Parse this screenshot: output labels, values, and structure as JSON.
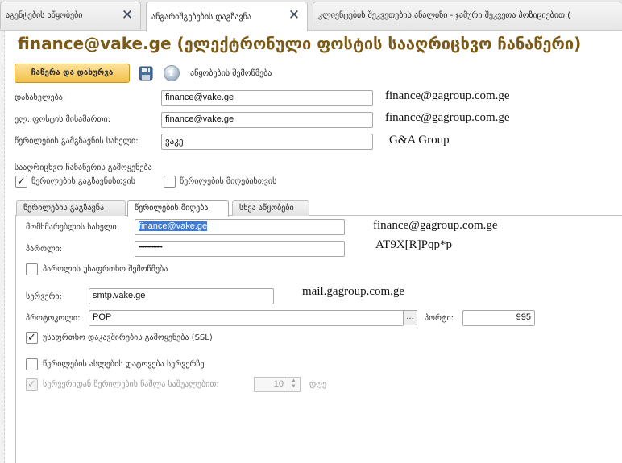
{
  "tabs": [
    {
      "label": "აგენტების აწყობები"
    },
    {
      "label": "ანგარიშგებების დაგზავნა"
    },
    {
      "label": "კლიენტების შეკვეთების ანალიზი - ჯამური შეკვეთა პოზიციებით ("
    }
  ],
  "title": "finance@vake.ge (ელექტრონული ფოსტის სააღრიცხვო ჩანაწერი)",
  "toolbar": {
    "save_close_label": "ჩაწერა და დახურვა",
    "settings_check_label": "აწყობების შემოწმება"
  },
  "account": {
    "name_label": "დასახელება:",
    "name_value": "finance@vake.ge",
    "email_label": "ელ. ფოსტის მისამართი:",
    "email_value": "finance@vake.ge",
    "sender_label": "წერილების გამგზავნის სახელი:",
    "sender_value": "ვაკე",
    "note_name": "finance@gagroup.com.ge",
    "note_email": "finance@gagroup.com.ge",
    "note_sender": "G&A Group"
  },
  "usage": {
    "heading": "სააღრიცხვო ჩანაწერის გამოყენება",
    "send_label": "წერილების გაგზავნისთვის",
    "send_checked": true,
    "receive_label": "წერილების მიღებისთვის",
    "receive_checked": false
  },
  "inner_tabs": [
    {
      "label": "წერილების გაგზავნა"
    },
    {
      "label": "წერილების მიღება"
    },
    {
      "label": "სხვა აწყობები"
    }
  ],
  "receive": {
    "user_label": "მომხმარებლის სახელი:",
    "user_value": "finance@vake.ge",
    "password_label": "პაროლი:",
    "password_value": "••••••••••••••••",
    "secure_pwd_label": "პაროლის უსაფრთხო შემოწმება",
    "secure_pwd_checked": false,
    "server_label": "სერვერი:",
    "server_value": "smtp.vake.ge",
    "protocol_label": "პროტოკოლი:",
    "protocol_value": "POP",
    "protocol_btn": "...",
    "port_label": "პორტი:",
    "port_value": "995",
    "ssl_label": "უსაფრთხო დაკავშირების გამოყენება (SSL)",
    "ssl_checked": true,
    "leave_label": "წერილების ასლების დატოვება სერვერზე",
    "leave_checked": false,
    "delete_label": "სერვერიდან წერილების წაშლა საშუალებით:",
    "delete_checked": true,
    "delete_days": "10",
    "days_unit": "დღე",
    "note_user": "finance@gagroup.com.ge",
    "note_password": "AT9X[R]Pqp*p",
    "note_server": "mail.gagroup.com.ge"
  },
  "colors": {
    "title": "#7a5a16",
    "save_button": "#f2bf4a",
    "selection": "#3d7bd6"
  },
  "icons": [
    "close-icon",
    "save-disk-icon",
    "info-icon",
    "checkmark-icon",
    "spin-arrows-icon"
  ]
}
